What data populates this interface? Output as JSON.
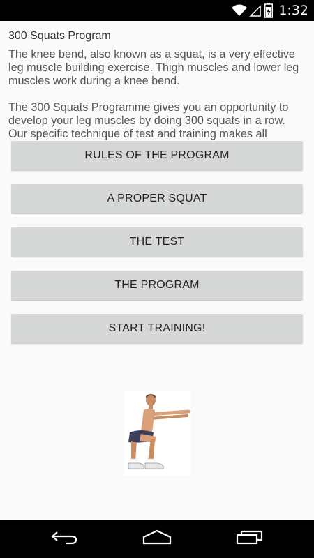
{
  "status_bar": {
    "time": "1:32",
    "icons": [
      "wifi-icon",
      "signal-icon",
      "battery-icon"
    ]
  },
  "page": {
    "title": "300 Squats Program",
    "paragraphs": [
      "The knee bend, also known as a squat, is a very effective leg muscle building exercise. Thigh muscles and lower leg muscles work during a knee bend.",
      "The 300 Squats Programme gives you an opportunity to develop your leg muscles by doing 300 squats in a row. Our specific technique of test and training makes all"
    ]
  },
  "buttons": {
    "rules": "RULES OF THE PROGRAM",
    "proper_squat": "A PROPER SQUAT",
    "test": "THE TEST",
    "program": "THE PROGRAM",
    "start": "START TRAINING!"
  },
  "illustration": {
    "icon": "man-squatting-illustration"
  },
  "nav_bar": {
    "icons": [
      "back-icon",
      "home-icon",
      "recents-icon"
    ]
  },
  "colors": {
    "button_bg": "#d6d7d7",
    "background": "#fafafa",
    "bars": "#000000"
  }
}
